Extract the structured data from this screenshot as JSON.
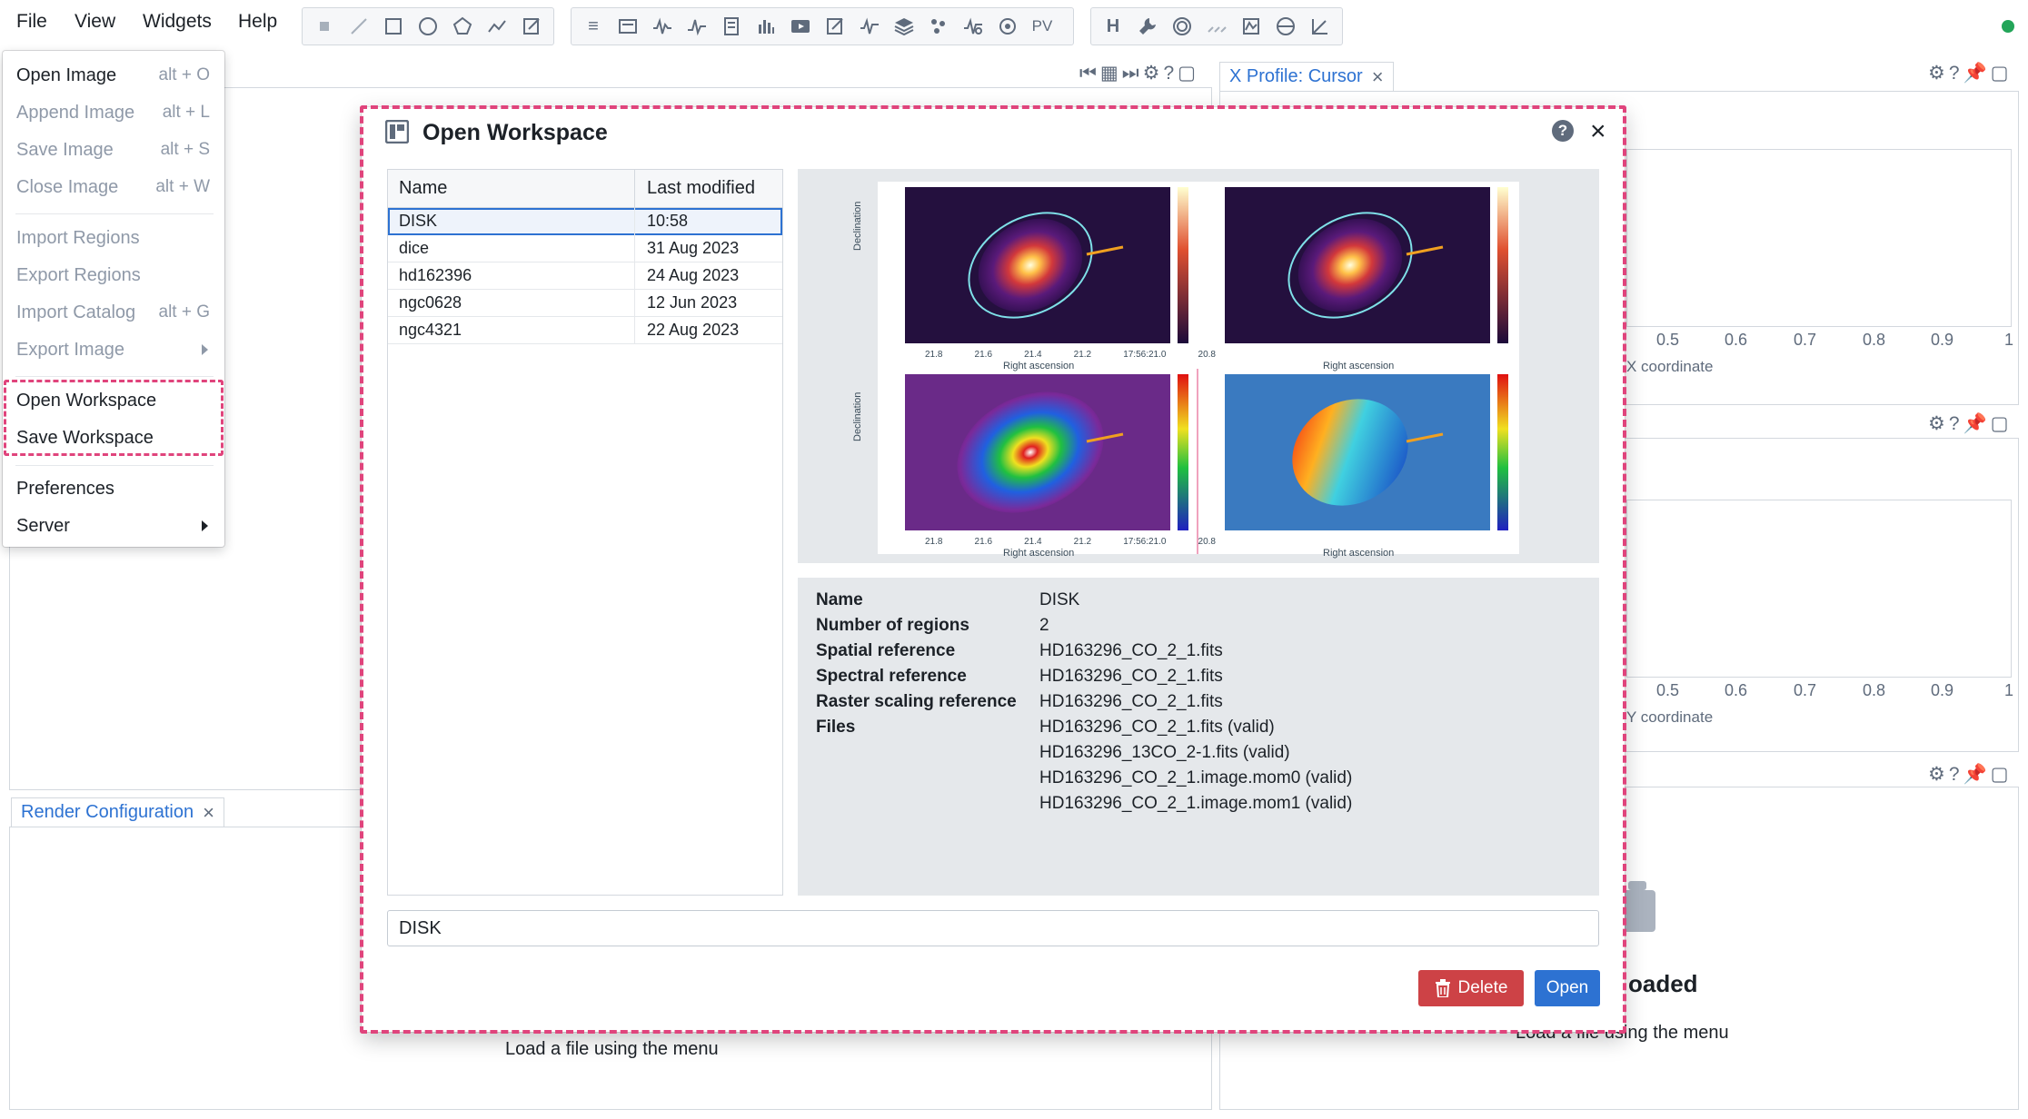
{
  "menubar": {
    "items": [
      "File",
      "View",
      "Widgets",
      "Help"
    ]
  },
  "toolbar": {
    "pv_label": "PV",
    "h_label": "H"
  },
  "file_menu": {
    "items": [
      {
        "label": "Open Image",
        "shortcut": "alt + O",
        "enabled": true
      },
      {
        "label": "Append Image",
        "shortcut": "alt + L",
        "enabled": false
      },
      {
        "label": "Save Image",
        "shortcut": "alt + S",
        "enabled": false
      },
      {
        "label": "Close Image",
        "shortcut": "alt + W",
        "enabled": false
      },
      {
        "label": "Import Regions",
        "shortcut": "",
        "enabled": false
      },
      {
        "label": "Export Regions",
        "shortcut": "",
        "enabled": false
      },
      {
        "label": "Import Catalog",
        "shortcut": "alt + G",
        "enabled": false
      },
      {
        "label": "Export Image",
        "shortcut": "",
        "enabled": false
      },
      {
        "label": "Open Workspace",
        "shortcut": "",
        "enabled": true
      },
      {
        "label": "Save Workspace",
        "shortcut": "",
        "enabled": true
      },
      {
        "label": "Preferences",
        "shortcut": "",
        "enabled": true
      },
      {
        "label": "Server",
        "shortcut": "",
        "enabled": true
      }
    ]
  },
  "background": {
    "x_profile_tab": "X Profile: Cursor",
    "render_config_tab": "Render Configuration",
    "x_ticks": [
      "0.5",
      "0.6",
      "0.7",
      "0.8",
      "0.9",
      "1"
    ],
    "x_axis_label": "X coordinate",
    "y_axis_label": "Y coordinate",
    "no_file_title": "oaded",
    "no_file_hint_left": "Load a file using the menu",
    "no_file_hint_right": "Load a file using the menu"
  },
  "dialog": {
    "title": "Open Workspace",
    "table": {
      "headers": [
        "Name",
        "Last modified"
      ],
      "rows": [
        {
          "name": "DISK",
          "modified": "10:58"
        },
        {
          "name": "dice",
          "modified": "31 Aug 2023"
        },
        {
          "name": "hd162396",
          "modified": "24 Aug 2023"
        },
        {
          "name": "ngc0628",
          "modified": "12 Jun 2023"
        },
        {
          "name": "ngc4321",
          "modified": "22 Aug 2023"
        }
      ]
    },
    "info": {
      "labels": {
        "name": "Name",
        "regions": "Number of regions",
        "spatial": "Spatial reference",
        "spectral": "Spectral reference",
        "raster": "Raster scaling reference",
        "files": "Files"
      },
      "values": {
        "name": "DISK",
        "regions": "2",
        "spatial": "HD163296_CO_2_1.fits",
        "spectral": "HD163296_CO_2_1.fits",
        "raster": "HD163296_CO_2_1.fits",
        "files": [
          "HD163296_CO_2_1.fits (valid)",
          "HD163296_13CO_2-1.fits (valid)",
          "HD163296_CO_2_1.image.mom0 (valid)",
          "HD163296_CO_2_1.image.mom1 (valid)"
        ]
      }
    },
    "preview": {
      "axis_x": "Right ascension",
      "axis_y": "Declination",
      "ticks_x": [
        "21.8",
        "21.6",
        "21.4",
        "21.2",
        "17:56:21.0",
        "20.8"
      ]
    },
    "input_value": "DISK",
    "delete_label": "Delete",
    "open_label": "Open"
  }
}
